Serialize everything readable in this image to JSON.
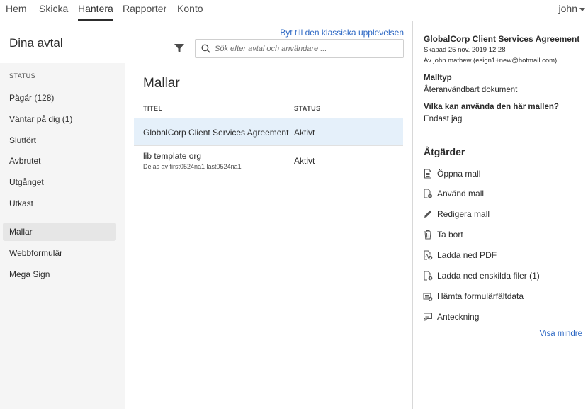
{
  "nav": {
    "tabs": [
      {
        "label": "Hem"
      },
      {
        "label": "Skicka"
      },
      {
        "label": "Hantera"
      },
      {
        "label": "Rapporter"
      },
      {
        "label": "Konto"
      }
    ],
    "active_tab": "Hantera",
    "user": "john"
  },
  "header": {
    "title": "Dina avtal",
    "switch_link": "Byt till den klassiska upplevelsen",
    "search_placeholder": "Sök efter avtal och användare ..."
  },
  "sidebar": {
    "section_label": "STATUS",
    "items": [
      {
        "label": "Pågår (128)"
      },
      {
        "label": "Väntar på dig (1)"
      },
      {
        "label": "Slutfört"
      },
      {
        "label": "Avbrutet"
      },
      {
        "label": "Utgånget"
      },
      {
        "label": "Utkast"
      },
      {
        "label": "Mallar"
      },
      {
        "label": "Webbformulär"
      },
      {
        "label": "Mega Sign"
      }
    ],
    "active_item": "Mallar"
  },
  "main": {
    "heading": "Mallar",
    "columns": {
      "title": "TITEL",
      "status": "STATUS"
    },
    "rows": [
      {
        "title": "GlobalCorp Client Services Agreement",
        "sub": "",
        "status": "Aktivt",
        "selected": true
      },
      {
        "title": "lib template org",
        "sub": "Delas av first0524na1 last0524na1",
        "status": "Aktivt",
        "selected": false
      }
    ]
  },
  "details": {
    "title": "GlobalCorp Client Services Agreement",
    "created": "Skapad 25 nov. 2019 12:28",
    "by": "Av john mathew (esign1+new@hotmail.com)",
    "type_label": "Malltyp",
    "type_value": "Återanvändbart dokument",
    "who_label": "Vilka kan använda den här mallen?",
    "who_value": "Endast jag",
    "actions_heading": "Åtgärder",
    "actions": [
      {
        "label": "Öppna mall",
        "icon": "document-icon"
      },
      {
        "label": "Använd mall",
        "icon": "use-template-icon"
      },
      {
        "label": "Redigera mall",
        "icon": "pencil-icon"
      },
      {
        "label": "Ta bort",
        "icon": "trash-icon"
      },
      {
        "label": "Ladda ned PDF",
        "icon": "download-pdf-icon"
      },
      {
        "label": "Ladda ned enskilda filer (1)",
        "icon": "download-files-icon"
      },
      {
        "label": "Hämta formulärfältdata",
        "icon": "form-data-icon"
      },
      {
        "label": "Anteckning",
        "icon": "note-icon"
      }
    ],
    "show_less": "Visa mindre"
  },
  "colors": {
    "link": "#2d68c4",
    "selected_row": "#e5f0fa",
    "sidebar_bg": "#f5f5f5",
    "sidebar_active": "#e6e6e6"
  }
}
